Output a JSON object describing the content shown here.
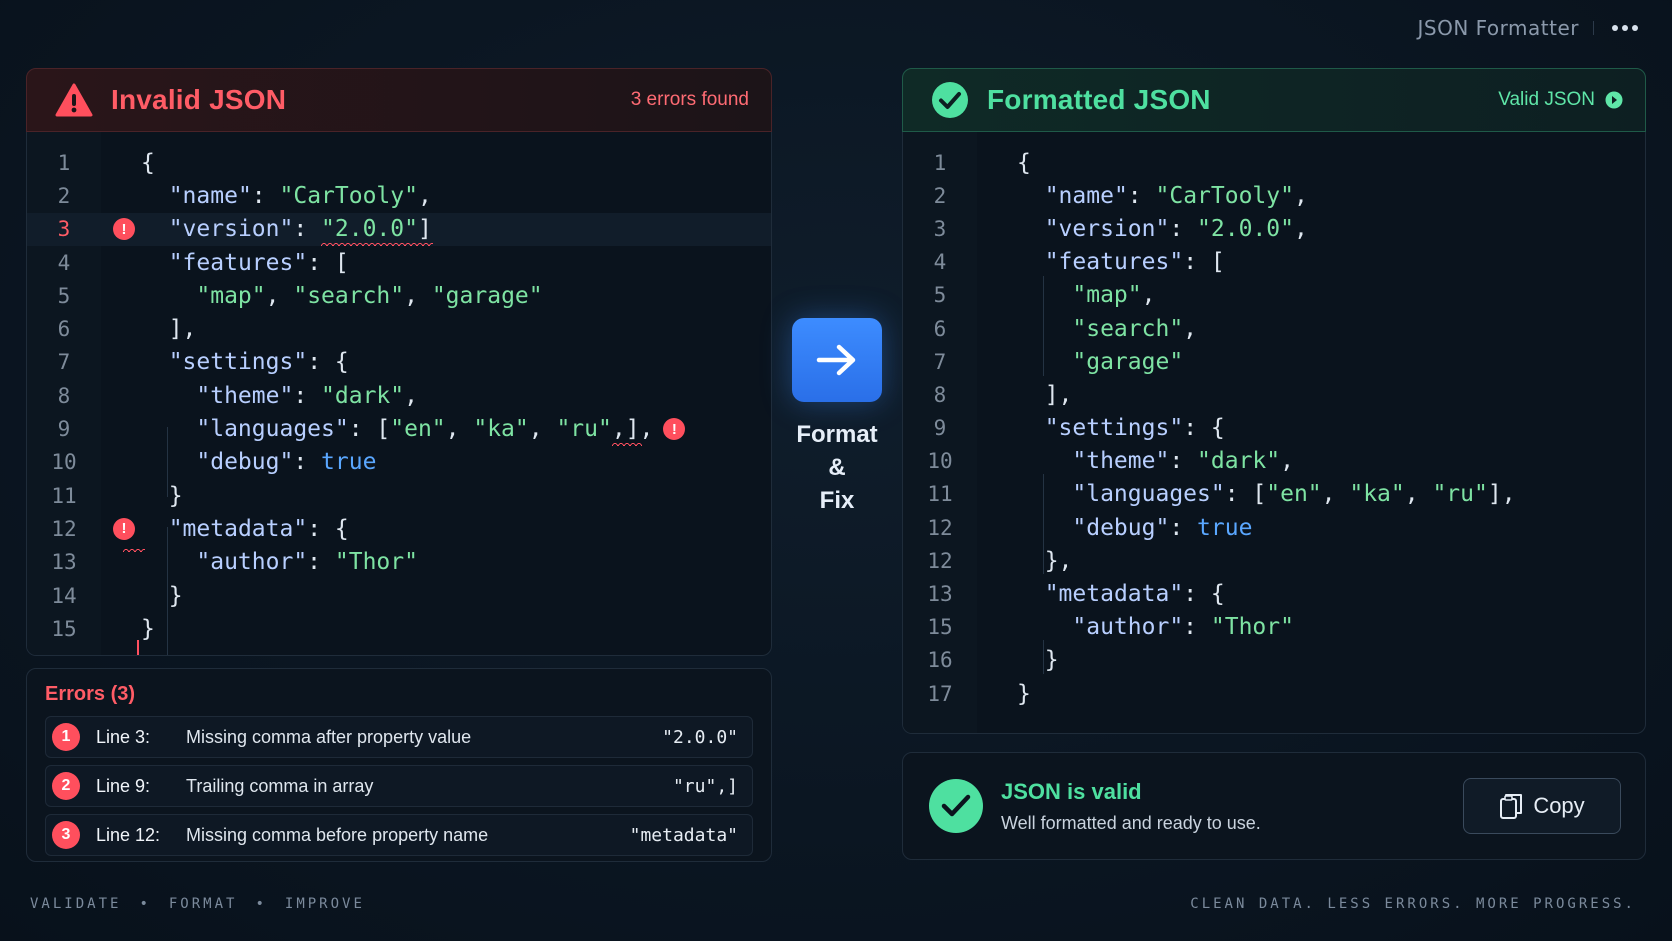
{
  "app": {
    "title": "JSON Formatter"
  },
  "left": {
    "title": "Invalid JSON",
    "errors_found": "3 errors found",
    "lines": [
      {
        "n": "1"
      },
      {
        "n": "2"
      },
      {
        "n": "3"
      },
      {
        "n": "4"
      },
      {
        "n": "5"
      },
      {
        "n": "6"
      },
      {
        "n": "7"
      },
      {
        "n": "8"
      },
      {
        "n": "9"
      },
      {
        "n": "10"
      },
      {
        "n": "11"
      },
      {
        "n": "12"
      },
      {
        "n": "13"
      },
      {
        "n": "14"
      },
      {
        "n": "15"
      }
    ],
    "errors_title": "Errors (3)",
    "errors": [
      {
        "num": "1",
        "line": "Line 3:",
        "message": "Missing comma after property value",
        "snippet": "\"2.0.0\""
      },
      {
        "num": "2",
        "line": "Line 9:",
        "message": "Trailing comma in array",
        "snippet": "\"ru\",]"
      },
      {
        "num": "3",
        "line": "Line 12:",
        "message": "Missing comma before property name",
        "snippet": "\"metadata\""
      }
    ]
  },
  "center": {
    "line1": "Format",
    "line2": "&",
    "line3": "Fix"
  },
  "right": {
    "title": "Formatted JSON",
    "status": "Valid JSON",
    "lines": [
      {
        "n": "1"
      },
      {
        "n": "2"
      },
      {
        "n": "3"
      },
      {
        "n": "4"
      },
      {
        "n": "5"
      },
      {
        "n": "6"
      },
      {
        "n": "7"
      },
      {
        "n": "8"
      },
      {
        "n": "9"
      },
      {
        "n": "10"
      },
      {
        "n": "11"
      },
      {
        "n": "12"
      },
      {
        "n": "12"
      },
      {
        "n": "13"
      },
      {
        "n": "15"
      },
      {
        "n": "16"
      },
      {
        "n": "17"
      }
    ],
    "valid_title": "JSON is valid",
    "valid_sub": "Well formatted and ready to use.",
    "copy_label": "Copy"
  },
  "code": {
    "name_key": "\"name\"",
    "name_val": "\"CarTooly\"",
    "version_key": "\"version\"",
    "version_val": "\"2.0.0\"",
    "features_key": "\"features\"",
    "map": "\"map\"",
    "search": "\"search\"",
    "garage": "\"garage\"",
    "settings_key": "\"settings\"",
    "theme_key": "\"theme\"",
    "theme_val": "\"dark\"",
    "languages_key": "\"languages\"",
    "en": "\"en\"",
    "ka": "\"ka\"",
    "ru": "\"ru\"",
    "debug_key": "\"debug\"",
    "debug_val": "true",
    "metadata_key": "\"metadata\"",
    "author_key": "\"author\"",
    "author_val": "\"Thor\""
  },
  "footer": {
    "left": [
      "VALIDATE",
      "•",
      "FORMAT",
      "•",
      "IMPROVE"
    ],
    "right": "CLEAN DATA. LESS ERRORS. MORE PROGRESS."
  },
  "colors": {
    "error": "#ff5c66",
    "success": "#4ee0a0",
    "accent": "#3d8cff"
  },
  "icons": [
    "warning-triangle-icon",
    "check-circle-icon",
    "arrow-right-icon",
    "copy-icon",
    "more-dots-icon",
    "error-dot-icon"
  ]
}
